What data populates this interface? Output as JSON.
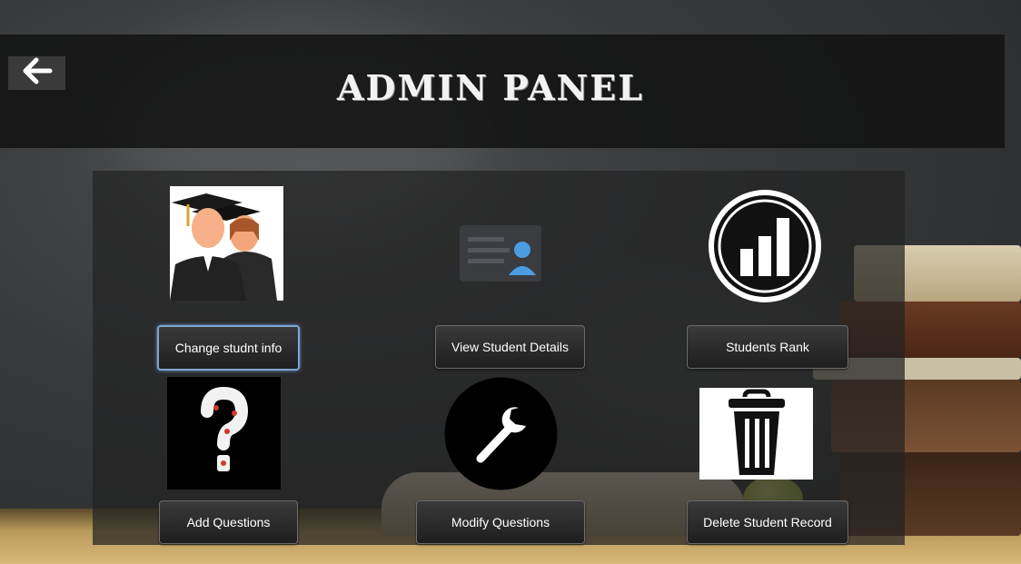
{
  "header": {
    "title": "ADMIN PANEL",
    "back_icon": "arrow-left-icon"
  },
  "tiles": {
    "change_info": {
      "label": "Change studnt info",
      "icon": "graduates-icon"
    },
    "view_details": {
      "label": "View Student Details",
      "icon": "id-card-icon"
    },
    "rank": {
      "label": "Students Rank",
      "icon": "bar-chart-icon"
    },
    "add_questions": {
      "label": "Add Questions",
      "icon": "question-mark-icon"
    },
    "modify_questions": {
      "label": "Modify Questions",
      "icon": "wrench-icon"
    },
    "delete_record": {
      "label": "Delete Student Record",
      "icon": "trash-icon"
    }
  },
  "colors": {
    "accent_focus": "#7fa6d6",
    "button_bg": "#2a2a2a",
    "id_card_avatar": "#4a9de0"
  }
}
